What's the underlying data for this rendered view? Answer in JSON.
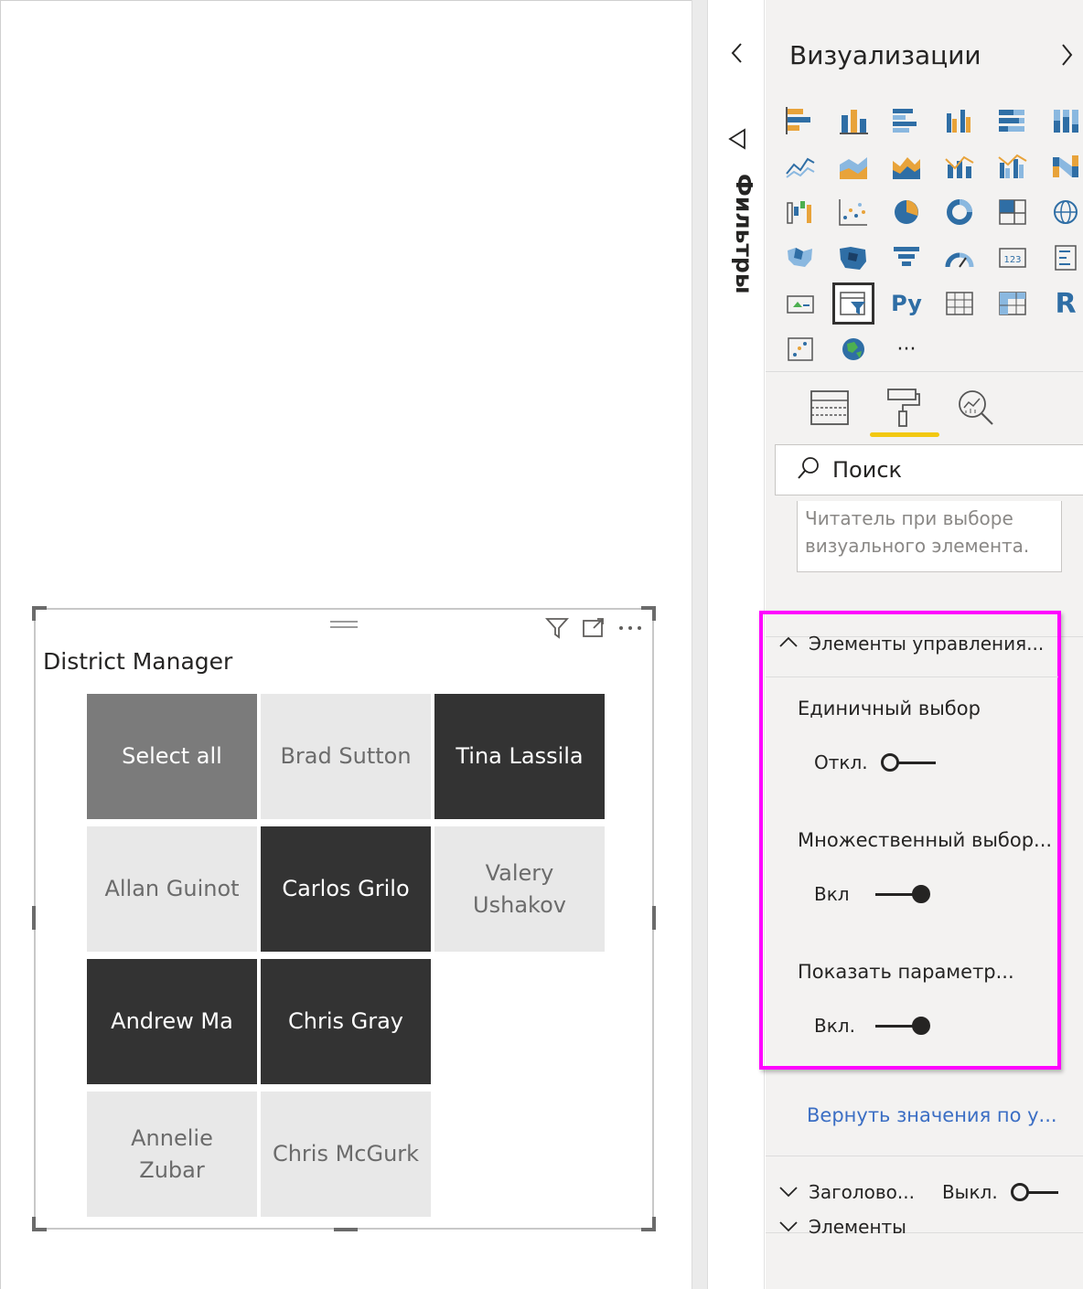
{
  "slicer": {
    "title": "District Manager",
    "tiles": [
      {
        "label": "Select all",
        "state": "all"
      },
      {
        "label": "Brad Sutton",
        "state": "unsel"
      },
      {
        "label": "Tina Lassila",
        "state": "sel"
      },
      {
        "label": "Allan Guinot",
        "state": "unsel"
      },
      {
        "label": "Carlos Grilo",
        "state": "sel"
      },
      {
        "label": "Valery Ushakov",
        "state": "unsel"
      },
      {
        "label": "Andrew Ma",
        "state": "sel"
      },
      {
        "label": "Chris Gray",
        "state": "sel"
      },
      {
        "label": "",
        "state": "empty"
      },
      {
        "label": "Annelie Zubar",
        "state": "unsel"
      },
      {
        "label": "Chris McGurk",
        "state": "unsel"
      }
    ]
  },
  "filters": {
    "label": "Фильтры"
  },
  "viz_pane": {
    "title": "Визуализации",
    "python_label": "Py",
    "r_label": "R",
    "more_label": "···",
    "search_placeholder": "Поиск",
    "alt_text": "Читатель при выборе визуального элемента."
  },
  "selection_controls": {
    "header": "Элементы управления...",
    "single_select": {
      "label": "Единичный выбор",
      "state_text": "Откл.",
      "on": false
    },
    "multi_select": {
      "label": "Множественный выбор...",
      "state_text": "Вкл",
      "on": true
    },
    "show_select_all": {
      "label": "Показать параметр...",
      "state_text": "Вкл.",
      "on": true
    },
    "reset": "Вернуть значения по у..."
  },
  "bottom_sections": {
    "header": {
      "label": "Заголово...",
      "state_text": "Выкл.",
      "on": false
    },
    "items": {
      "label": "Элементы"
    }
  },
  "colors": {
    "selected_tile": "#333333",
    "unselected_tile": "#e8e8e8",
    "select_all_tile": "#7b7b7b",
    "highlight": "#ff00ff",
    "active_tab_underline": "#f2c811",
    "link": "#3b6ec4"
  }
}
